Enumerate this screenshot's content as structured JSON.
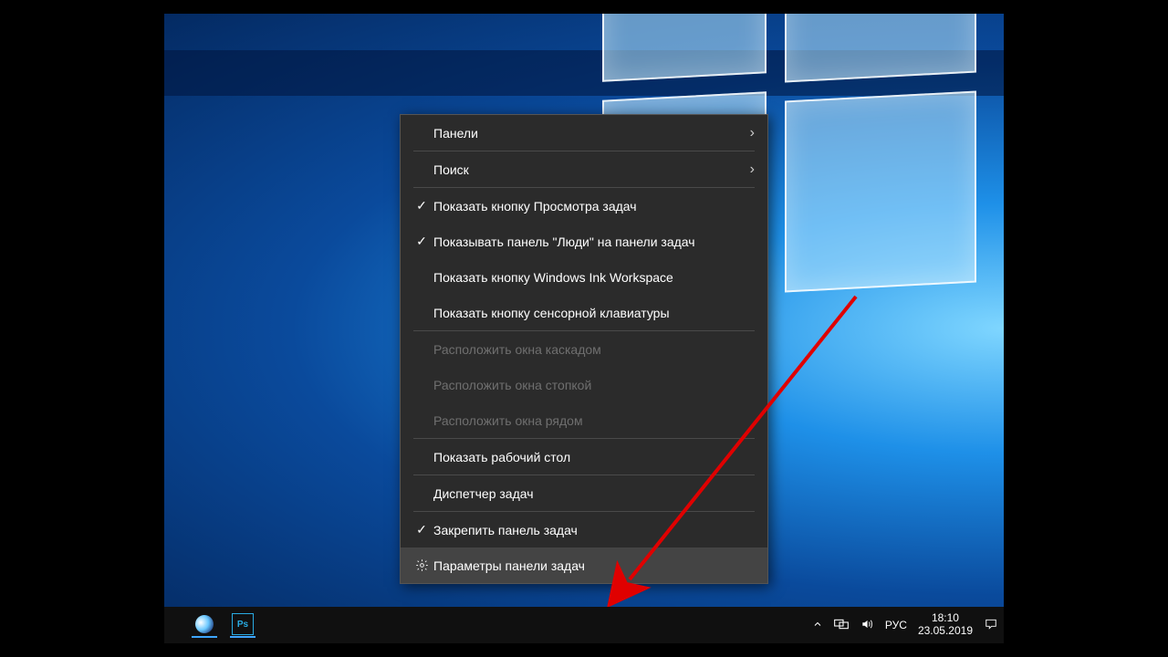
{
  "menu": {
    "items": [
      {
        "label": "Панели",
        "submenu": true
      },
      {
        "label": "Поиск",
        "submenu": true
      },
      {
        "label": "Показать кнопку Просмотра задач",
        "checked": true
      },
      {
        "label": "Показывать панель \"Люди\" на панели задач",
        "checked": true
      },
      {
        "label": "Показать кнопку Windows Ink Workspace"
      },
      {
        "label": "Показать кнопку сенсорной клавиатуры"
      },
      {
        "label": "Расположить окна каскадом",
        "disabled": true
      },
      {
        "label": "Расположить окна стопкой",
        "disabled": true
      },
      {
        "label": "Расположить окна рядом",
        "disabled": true
      },
      {
        "label": "Показать рабочий стол"
      },
      {
        "label": "Диспетчер задач"
      },
      {
        "label": "Закрепить панель задач",
        "checked": true
      },
      {
        "label": "Параметры панели задач",
        "icon": "gear",
        "hover": true
      }
    ]
  },
  "taskbar": {
    "ps_label": "Ps",
    "language": "РУС",
    "time": "18:10",
    "date": "23.05.2019"
  },
  "annotation": {
    "color": "#e00000"
  }
}
